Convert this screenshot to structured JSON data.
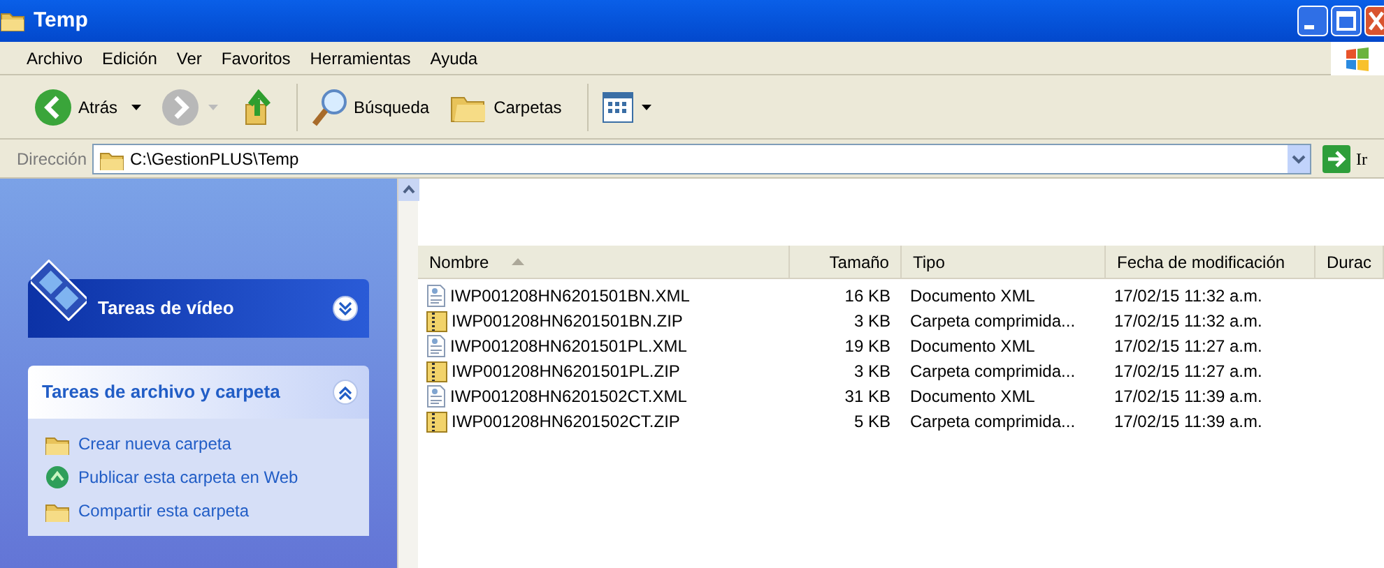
{
  "window": {
    "title": "Temp"
  },
  "menu": [
    "Archivo",
    "Edición",
    "Ver",
    "Favoritos",
    "Herramientas",
    "Ayuda"
  ],
  "toolbar": {
    "back": "Atrás",
    "search": "Búsqueda",
    "folders": "Carpetas"
  },
  "address": {
    "label": "Dirección",
    "value": "C:\\GestionPLUS\\Temp",
    "go": "Ir"
  },
  "sidebar": {
    "panels": [
      {
        "title": "Tareas de vídeo",
        "kind": "special",
        "expanded": false
      },
      {
        "title": "Tareas de archivo y carpeta",
        "kind": "normal",
        "expanded": true,
        "items": [
          {
            "label": "Crear nueva carpeta",
            "kind": "new-folder"
          },
          {
            "label": "Publicar esta carpeta en Web",
            "kind": "publish"
          },
          {
            "label": "Compartir esta carpeta",
            "kind": "share"
          }
        ]
      }
    ]
  },
  "file_list": {
    "columns": [
      {
        "label": "Nombre",
        "sorted": true
      },
      {
        "label": "Tamaño",
        "sorted": false
      },
      {
        "label": "Tipo",
        "sorted": false
      },
      {
        "label": "Fecha de modificación",
        "sorted": false
      },
      {
        "label": "Durac",
        "sorted": false
      }
    ],
    "rows": [
      {
        "kind": "xml",
        "cells": [
          "IWP001208HN6201501BN.XML",
          "16 KB",
          "Documento XML",
          "17/02/15 11:32 a.m."
        ]
      },
      {
        "kind": "zip",
        "cells": [
          "IWP001208HN6201501BN.ZIP",
          "3 KB",
          "Carpeta comprimida...",
          "17/02/15 11:32 a.m."
        ]
      },
      {
        "kind": "xml",
        "cells": [
          "IWP001208HN6201501PL.XML",
          "19 KB",
          "Documento XML",
          "17/02/15 11:27 a.m."
        ]
      },
      {
        "kind": "zip",
        "cells": [
          "IWP001208HN6201501PL.ZIP",
          "3 KB",
          "Carpeta comprimida...",
          "17/02/15 11:27 a.m."
        ]
      },
      {
        "kind": "xml",
        "cells": [
          "IWP001208HN6201502CT.XML",
          "31 KB",
          "Documento XML",
          "17/02/15 11:39 a.m."
        ]
      },
      {
        "kind": "zip",
        "cells": [
          "IWP001208HN6201502CT.ZIP",
          "5 KB",
          "Carpeta comprimida...",
          "17/02/15 11:39 a.m."
        ]
      }
    ]
  }
}
